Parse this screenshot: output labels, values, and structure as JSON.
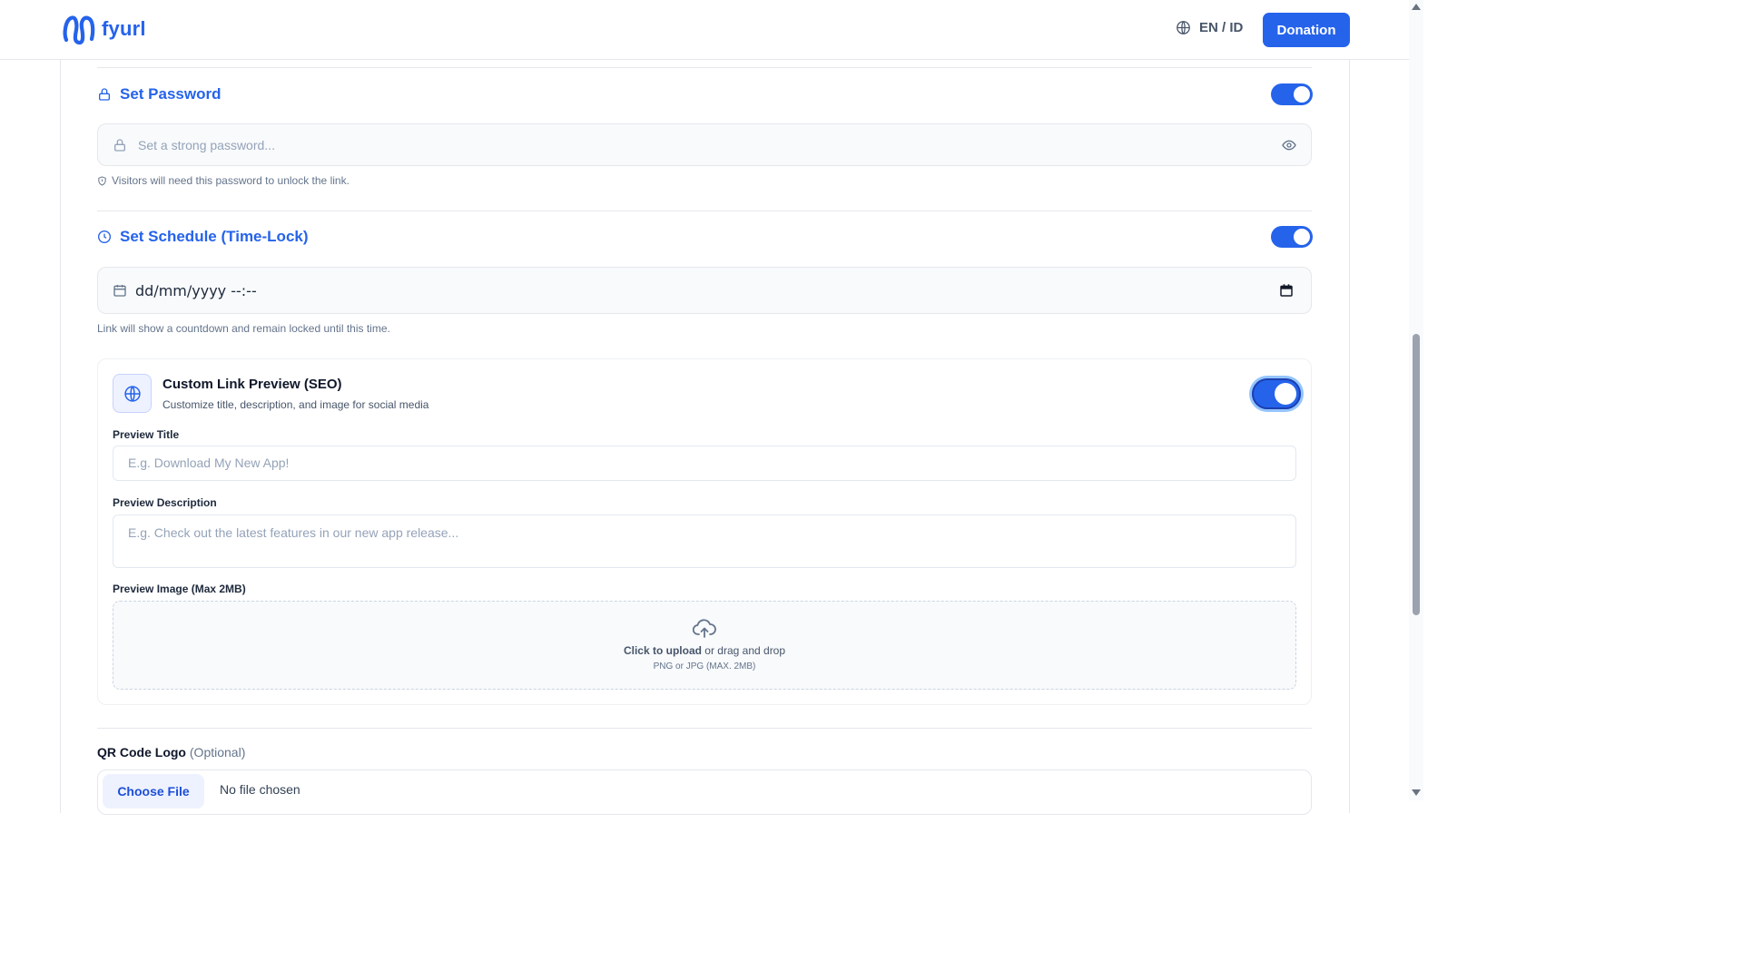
{
  "header": {
    "brand": "fyurl",
    "language": "EN / ID",
    "donation_label": "Donation"
  },
  "password": {
    "title": "Set Password",
    "enabled": true,
    "placeholder": "Set a strong password...",
    "hint": "Visitors will need this password to unlock the link."
  },
  "schedule": {
    "title": "Set Schedule (Time-Lock)",
    "enabled": true,
    "value": "dd/mm/yyyy --:--",
    "hint": "Link will show a countdown and remain locked until this time."
  },
  "seo": {
    "title": "Custom Link Preview (SEO)",
    "subtitle": "Customize title, description, and image for social media",
    "enabled": true,
    "preview_title_label": "Preview Title",
    "preview_title_placeholder": "E.g. Download My New App!",
    "preview_desc_label": "Preview Description",
    "preview_desc_placeholder": "E.g. Check out the latest features in our new app release...",
    "preview_image_label": "Preview Image (Max 2MB)",
    "upload_strong": "Click to upload",
    "upload_rest": " or drag and drop",
    "upload_formats": "PNG or JPG (MAX. 2MB)"
  },
  "qr": {
    "label": "QR Code Logo",
    "optional": "(Optional)",
    "choose_label": "Choose File",
    "status": "No file chosen"
  },
  "colors": {
    "accent": "#2563eb",
    "border": "#e5e7eb",
    "muted_text": "#64748b"
  }
}
